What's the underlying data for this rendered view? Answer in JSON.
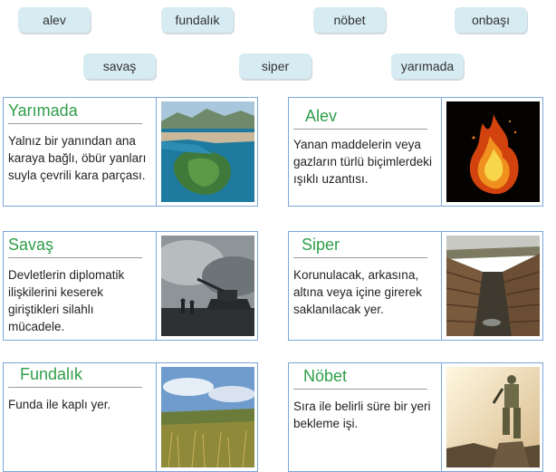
{
  "word_bank": [
    "alev",
    "fundalık",
    "nöbet",
    "onbaşı",
    "savaş",
    "siper",
    "yarımada"
  ],
  "cards": [
    {
      "title": "Yarımada",
      "description": "Yalnız bir yanından ana karaya bağlı, öbür yanları suyla çevrili kara parçası.",
      "image": "peninsula-photo"
    },
    {
      "title": "Alev",
      "description": "Yanan maddelerin veya gazların türlü biçimlerdeki ışıklı uzantısı.",
      "image": "flame-photo"
    },
    {
      "title": "Savaş",
      "description": "Devletlerin diplomatik ilişkilerini keserek giriştikleri silahlı mücadele.",
      "image": "war-scene-photo"
    },
    {
      "title": "Siper",
      "description": "Korunulacak, arkasına, altına veya içine girerek saklanılacak yer.",
      "image": "trench-photo"
    },
    {
      "title": "Fundalık",
      "description": "Funda ile kaplı yer.",
      "image": "heath-field-photo"
    },
    {
      "title": "Nöbet",
      "description": "Sıra ile belirli süre bir yeri bekleme işi.",
      "image": "soldier-on-watch-photo"
    }
  ]
}
